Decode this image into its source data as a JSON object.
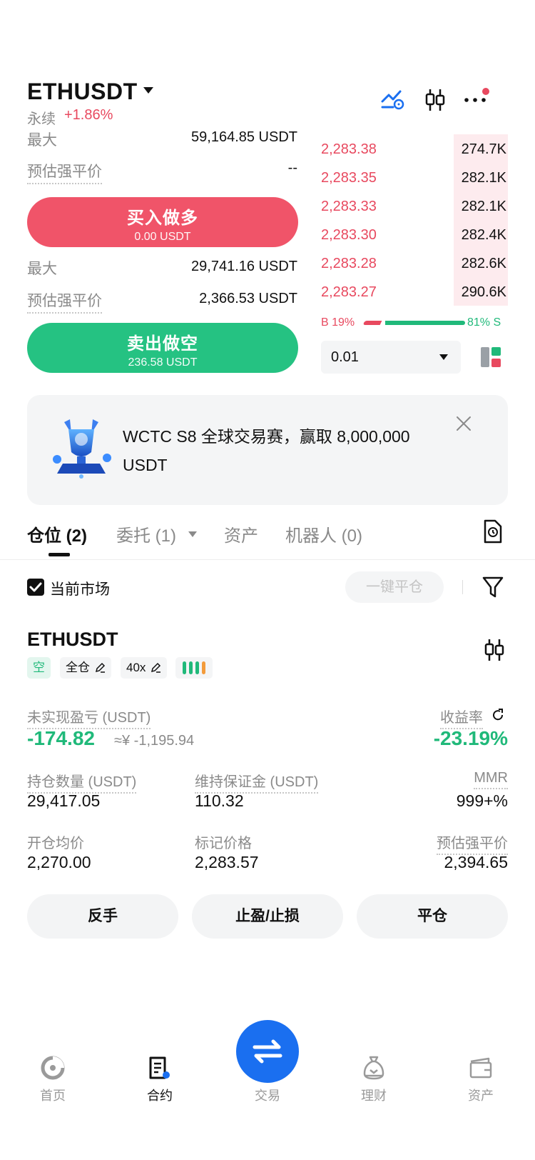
{
  "header": {
    "pair": "ETHUSDT",
    "type_label": "永续",
    "change": "+1.86%"
  },
  "long_panel": {
    "max_label": "最大",
    "max_value": "59,164.85 USDT",
    "liq_label": "预估强平价",
    "liq_value": "--",
    "button_label": "买入做多",
    "button_sub": "0.00 USDT"
  },
  "short_panel": {
    "max_label": "最大",
    "max_value": "29,741.16 USDT",
    "liq_label": "预估强平价",
    "liq_value": "2,366.53 USDT",
    "button_label": "卖出做空",
    "button_sub": "236.58 USDT"
  },
  "orderbook": {
    "asks": [
      {
        "price": "2,283.38",
        "size": "274.7K",
        "depth": 0.29
      },
      {
        "price": "2,283.35",
        "size": "282.1K",
        "depth": 0.29
      },
      {
        "price": "2,283.33",
        "size": "282.1K",
        "depth": 0.29
      },
      {
        "price": "2,283.30",
        "size": "282.4K",
        "depth": 0.29
      },
      {
        "price": "2,283.28",
        "size": "282.6K",
        "depth": 0.29
      },
      {
        "price": "2,283.27",
        "size": "290.6K",
        "depth": 0.29
      }
    ],
    "buy_ratio": "B 19%",
    "sell_ratio": "81% S",
    "buy_fraction": 0.19,
    "precision": "0.01"
  },
  "banner": {
    "text": "WCTC S8 全球交易赛，赢取 8,000,000 USDT"
  },
  "tabs": [
    {
      "label": "仓位 (2)"
    },
    {
      "label": "委托 (1)"
    },
    {
      "label": "资产"
    },
    {
      "label": "机器人 (0)"
    }
  ],
  "filter": {
    "current_market": "当前市场",
    "close_all": "一键平仓"
  },
  "position": {
    "symbol": "ETHUSDT",
    "side": "空",
    "margin_mode": "全仓",
    "leverage": "40x",
    "pnl_label": "未实现盈亏 (USDT)",
    "pnl_value": "-174.82",
    "pnl_cny": "≈¥ -1,195.94",
    "roe_label": "收益率",
    "roe_value": "-23.19%",
    "size_label": "持仓数量 (USDT)",
    "size_value": "29,417.05",
    "maint_label": "维持保证金 (USDT)",
    "maint_value": "110.32",
    "mmr_label": "MMR",
    "mmr_value": "999+%",
    "entry_label": "开仓均价",
    "entry_value": "2,270.00",
    "mark_label": "标记价格",
    "mark_value": "2,283.57",
    "liq_label": "预估强平价",
    "liq_value": "2,394.65"
  },
  "actions": {
    "reverse": "反手",
    "tpsl": "止盈/止损",
    "close": "平仓"
  },
  "bottom_nav": [
    {
      "label": "首页"
    },
    {
      "label": "合约"
    },
    {
      "label": "交易"
    },
    {
      "label": "理财"
    },
    {
      "label": "资产"
    }
  ],
  "colors": {
    "buy_red": "#e8495f",
    "sell_green": "#20b97a",
    "accent_blue": "#1a6ff0",
    "orange": "#f39b3b"
  }
}
